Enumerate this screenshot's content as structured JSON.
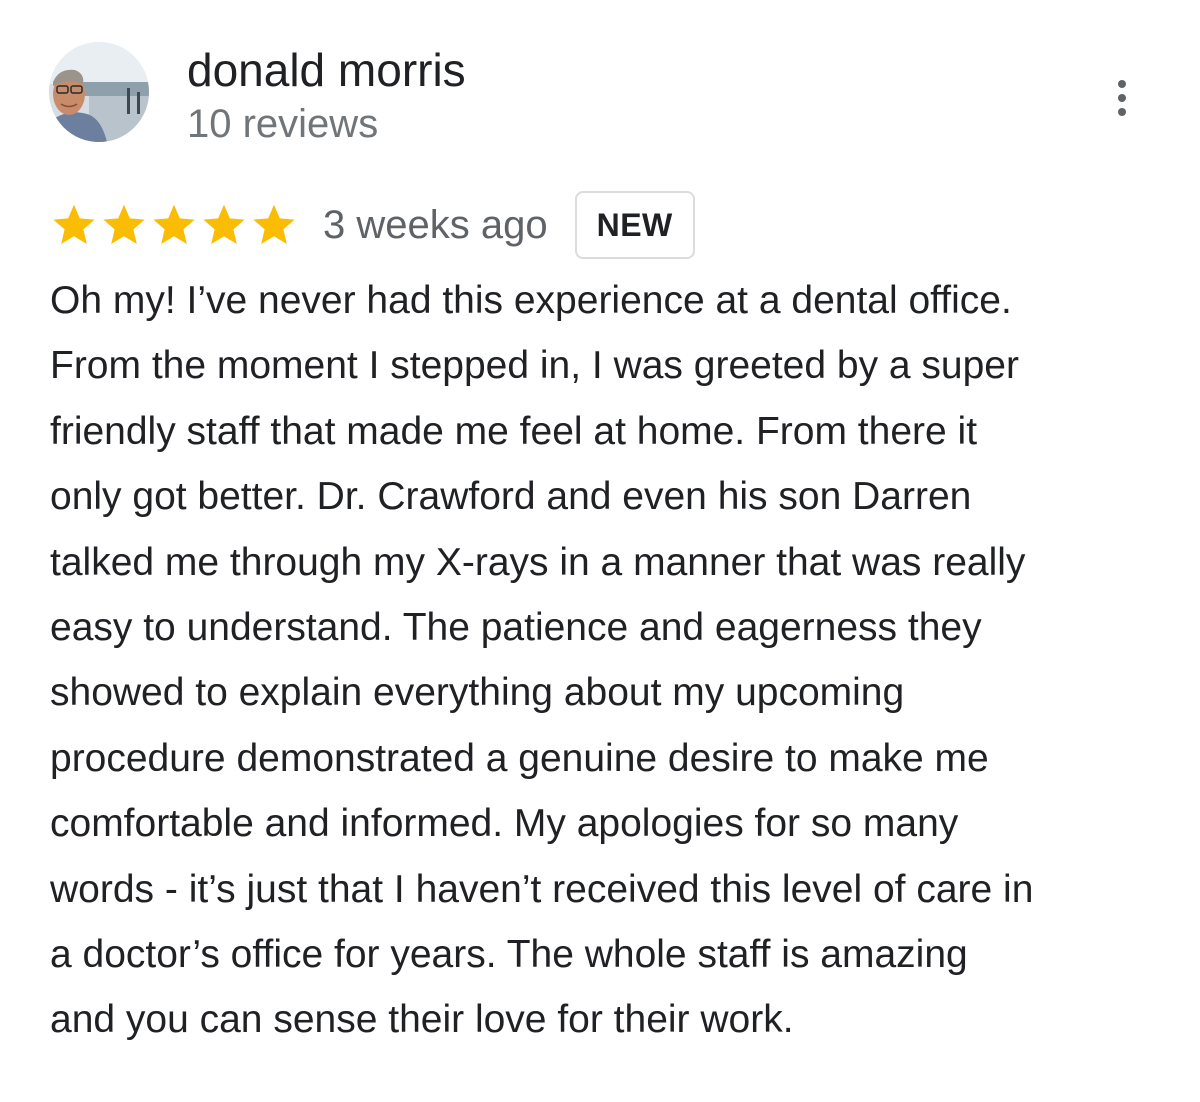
{
  "reviewer": {
    "name": "donald morris",
    "review_count": "10 reviews",
    "avatar": "reviewer-photo"
  },
  "menu": {
    "icon": "more-vert-icon"
  },
  "rating": {
    "stars": 5,
    "max_stars": 5,
    "star_color": "#fbbc04",
    "date": "3 weeks ago",
    "badge": "NEW"
  },
  "review": {
    "lines": [
      "Oh my! I’ve never had this experience at a dental office.",
      "From the moment I stepped in, I was greeted by a super",
      "friendly staff that made me feel at home. From there it",
      "only got better. Dr. Crawford and even his son Darren",
      "talked me through my X-rays in a manner that was really",
      "easy to understand. The patience and eagerness they",
      "showed to explain everything about my upcoming",
      "procedure demonstrated a genuine desire to make me",
      "comfortable and informed. My apologies for so many",
      "words - it’s just that I haven’t received this level of care in",
      "a doctor’s office for years. The whole staff is amazing",
      "and you can sense their love for their work."
    ]
  }
}
